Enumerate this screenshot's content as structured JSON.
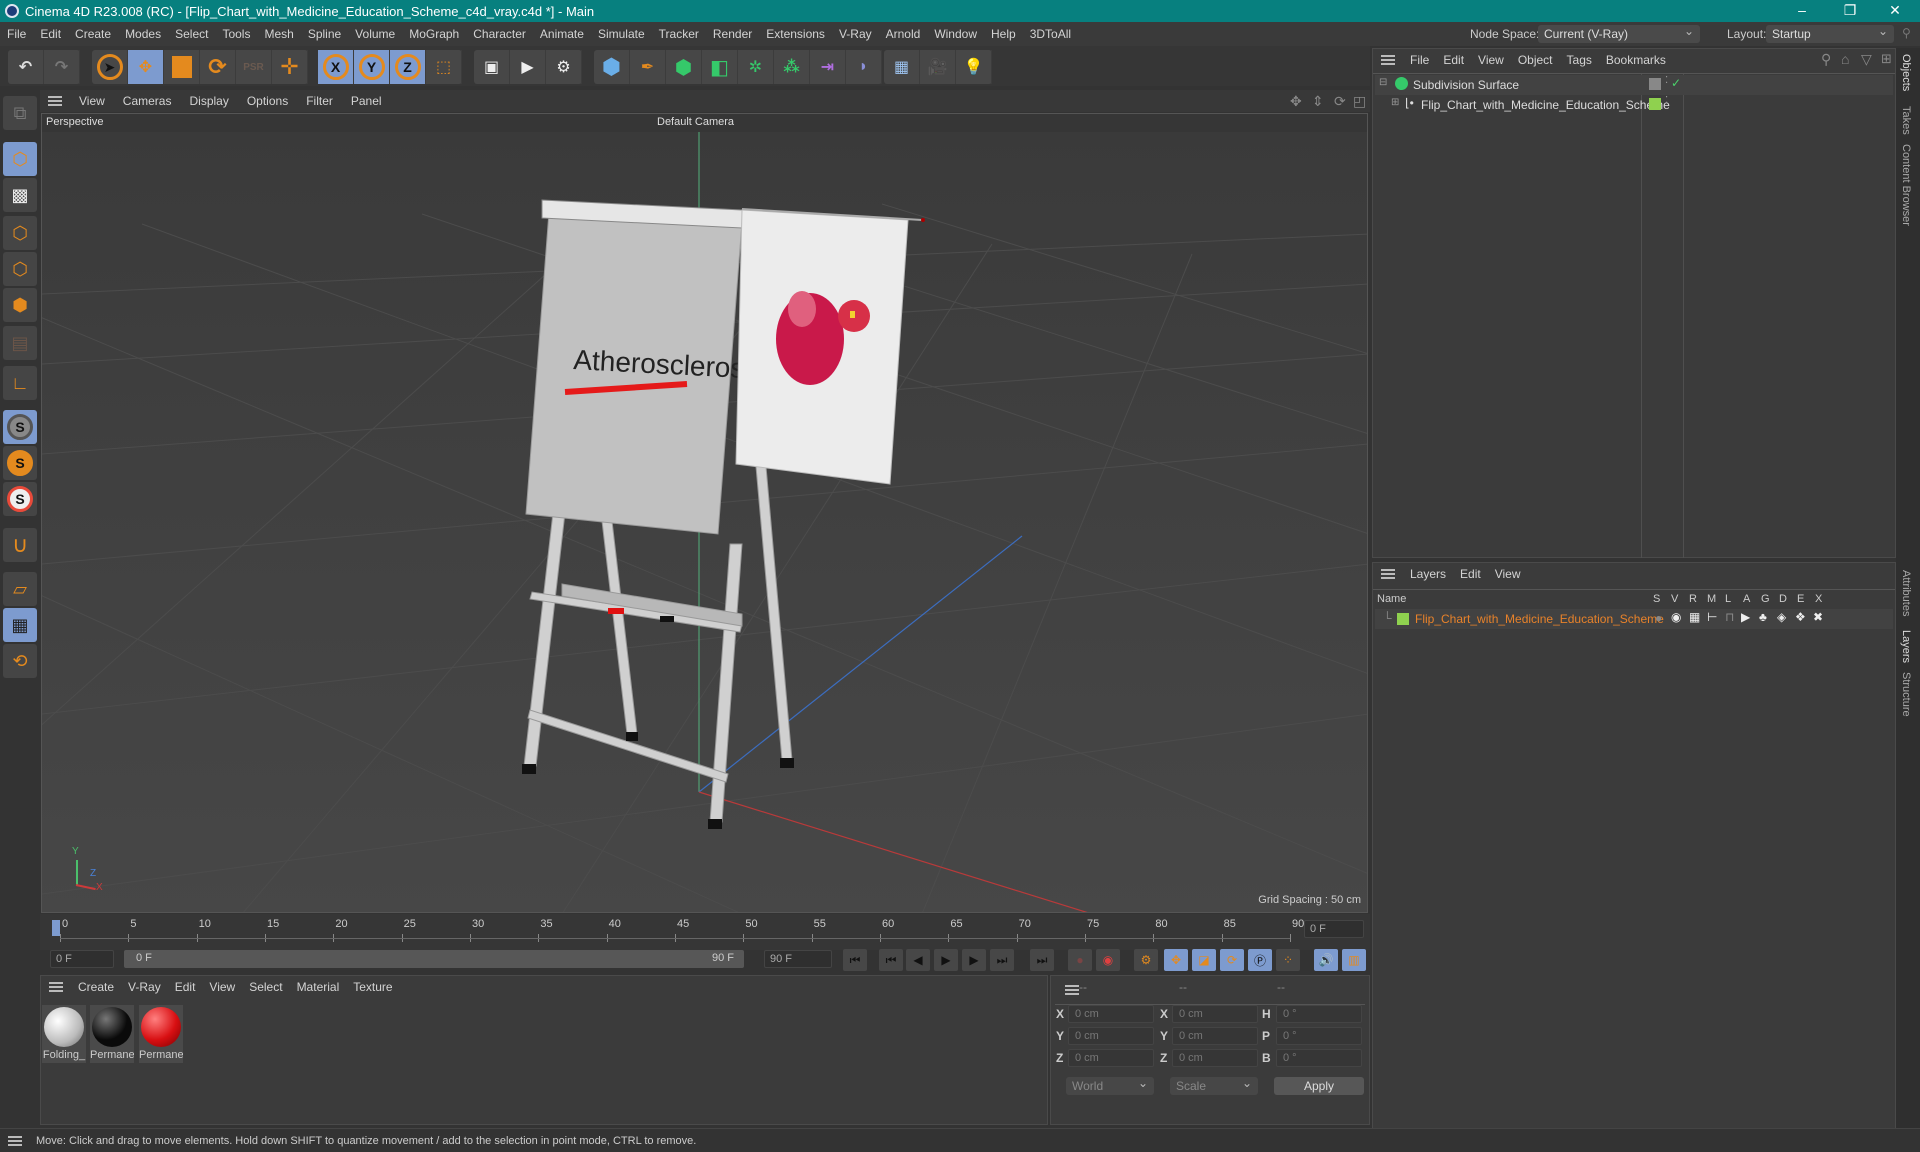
{
  "window": {
    "title": "Cinema 4D R23.008 (RC) - [Flip_Chart_with_Medicine_Education_Scheme_c4d_vray.c4d *] - Main",
    "controls": [
      "minimize",
      "restore",
      "close"
    ],
    "minimize_glyph": "–",
    "restore_glyph": "❐",
    "close_glyph": "✕"
  },
  "menubar": {
    "items": [
      "File",
      "Edit",
      "Create",
      "Modes",
      "Select",
      "Tools",
      "Mesh",
      "Spline",
      "Volume",
      "MoGraph",
      "Character",
      "Animate",
      "Simulate",
      "Tracker",
      "Render",
      "Extensions",
      "V-Ray",
      "Arnold",
      "Window",
      "Help",
      "3DToAll"
    ],
    "node_space_label": "Node Space:",
    "node_space_value": "Current (V-Ray)",
    "layout_label": "Layout:",
    "layout_value": "Startup"
  },
  "toolbar": {
    "undo": "↶",
    "redo": "↷",
    "axis_x": "X",
    "axis_y": "Y",
    "axis_z": "Z",
    "icons": [
      "undo-icon",
      "redo-icon",
      "select-icon",
      "move-icon",
      "scale-icon",
      "rotate-icon",
      "psr-icon",
      "add-icon",
      "x-axis-icon",
      "y-axis-icon",
      "z-axis-icon",
      "world-coord-icon",
      "render-view-icon",
      "render-picture-icon",
      "render-settings-icon",
      "cube-icon",
      "pen-icon",
      "subdivision-icon",
      "extrude-icon",
      "cloner-icon",
      "array-icon",
      "symmetry-icon",
      "deformer-icon",
      "floor-icon",
      "camera-icon",
      "light-icon"
    ]
  },
  "left_tools": [
    "model-mode",
    "texture-mode",
    "point-mode",
    "edge-mode",
    "polygon-mode",
    "uv-mode",
    "axis-mode",
    "snap-s",
    "snap-s-orange",
    "snap-s-ring",
    "magnet",
    "workplane",
    "locked-workplane",
    "workplane-rotate"
  ],
  "viewport": {
    "menu": [
      "View",
      "Cameras",
      "Display",
      "Options",
      "Filter",
      "Panel"
    ],
    "name": "Perspective",
    "camera": "Default Camera",
    "grid_spacing": "Grid Spacing : 50 cm",
    "chart_text": "Atherosclerosis",
    "axis_labels": {
      "x": "X",
      "y": "Y",
      "z": "Z"
    }
  },
  "timeline": {
    "ticks": [
      "0",
      "5",
      "10",
      "15",
      "20",
      "25",
      "30",
      "35",
      "40",
      "45",
      "50",
      "55",
      "60",
      "65",
      "70",
      "75",
      "80",
      "85",
      "90"
    ],
    "current_frame": "0 F",
    "start_field": "0 F",
    "range_start": "0 F",
    "range_end": "90 F",
    "end_field": "90 F"
  },
  "materials": {
    "menu": [
      "Create",
      "V-Ray",
      "Edit",
      "View",
      "Select",
      "Material",
      "Texture"
    ],
    "items": [
      {
        "name": "Folding_",
        "color": "#d8d8d8"
      },
      {
        "name": "Permane",
        "color": "#0a0a0a"
      },
      {
        "name": "Permane",
        "color": "#d80f12"
      }
    ]
  },
  "coordinates": {
    "headers": [
      "--",
      "--",
      "--"
    ],
    "rows": [
      {
        "l1": "X",
        "v1": "0 cm",
        "l2": "X",
        "v2": "0 cm",
        "l3": "H",
        "v3": "0 °"
      },
      {
        "l1": "Y",
        "v1": "0 cm",
        "l2": "Y",
        "v2": "0 cm",
        "l3": "P",
        "v3": "0 °"
      },
      {
        "l1": "Z",
        "v1": "0 cm",
        "l2": "Z",
        "v2": "0 cm",
        "l3": "B",
        "v3": "0 °"
      }
    ],
    "space": "World",
    "mode": "Scale",
    "apply": "Apply"
  },
  "objects": {
    "menu": [
      "File",
      "Edit",
      "View",
      "Object",
      "Tags",
      "Bookmarks"
    ],
    "tree": [
      {
        "name": "Subdivision Surface",
        "indent": 0
      },
      {
        "name": "Flip_Chart_with_Medicine_Education_Scheme",
        "indent": 1
      }
    ]
  },
  "layers": {
    "menu": [
      "Layers",
      "Edit",
      "View"
    ],
    "columns": [
      "Name",
      "S",
      "V",
      "R",
      "M",
      "L",
      "A",
      "G",
      "D",
      "E",
      "X"
    ],
    "rows": [
      {
        "name": "Flip_Chart_with_Medicine_Education_Scheme",
        "color": "#8fd14f"
      }
    ]
  },
  "side_tabs_top": [
    "Objects",
    "Takes",
    "Content Browser"
  ],
  "side_tabs_bottom": [
    "Attributes",
    "Layers",
    "Structure"
  ],
  "status": "Move: Click and drag to move elements. Hold down SHIFT to quantize movement / add to the selection in point mode, CTRL to remove.",
  "colors": {
    "accent": "#7d9bcf",
    "title": "#07807f",
    "orange": "#e48a1e",
    "layer_text": "#e8822a"
  }
}
